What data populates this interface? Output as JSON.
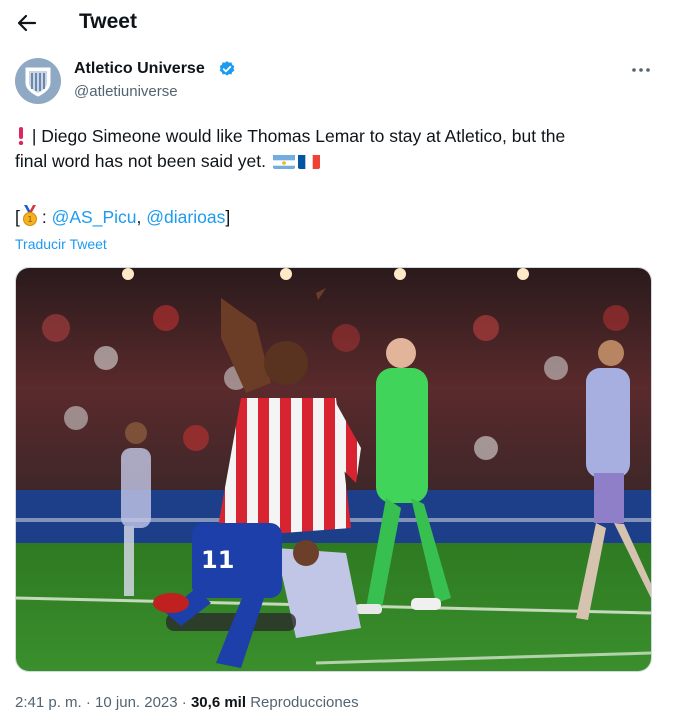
{
  "header": {
    "title": "Tweet"
  },
  "author": {
    "name": "Atletico Universe",
    "handle": "@atletiuniverse"
  },
  "tweet": {
    "line1": "| Diego Simeone would like Thomas Lemar to stay at Atletico, but the",
    "line2": "final word has not been said yet.",
    "credit_open": "[",
    "credit_colon": ":",
    "mention1": "@AS_Picu",
    "comma": ",",
    "mention2": "@diarioas",
    "credit_close": "]",
    "translate": "Traducir Tweet",
    "jersey_number": "11"
  },
  "meta": {
    "time": "2:41 p. m.",
    "date": "10 jun. 2023",
    "views": "30,6 mil",
    "views_label": "Reproducciones",
    "sep": "·"
  },
  "colors": {
    "accent": "#1d9bf0",
    "secondary": "#536471",
    "pitch": "#3a8f2c"
  },
  "icons": [
    "back-arrow-icon",
    "verified-badge-icon",
    "more-icon",
    "exclamation-icon",
    "argentina-flag-icon",
    "france-flag-icon",
    "medal-icon"
  ]
}
